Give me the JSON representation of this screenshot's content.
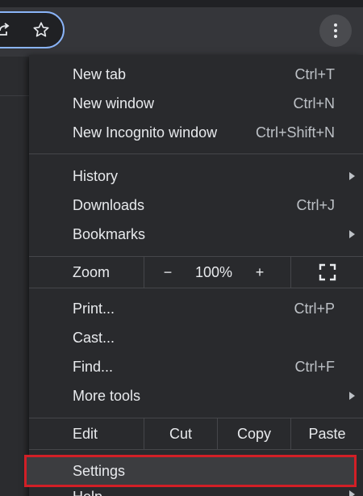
{
  "toolbar": {
    "share_icon": "share-icon",
    "star_icon": "star-icon",
    "menu_icon": "kebab-menu-icon"
  },
  "menu": {
    "group1": [
      {
        "label": "New tab",
        "shortcut": "Ctrl+T"
      },
      {
        "label": "New window",
        "shortcut": "Ctrl+N"
      },
      {
        "label": "New Incognito window",
        "shortcut": "Ctrl+Shift+N"
      }
    ],
    "group2": [
      {
        "label": "History",
        "shortcut": ""
      },
      {
        "label": "Downloads",
        "shortcut": "Ctrl+J"
      },
      {
        "label": "Bookmarks",
        "shortcut": ""
      }
    ],
    "zoom": {
      "label": "Zoom",
      "minus": "−",
      "value": "100%",
      "plus": "+",
      "fullscreen_icon": "fullscreen-icon"
    },
    "group3": [
      {
        "label": "Print...",
        "shortcut": "Ctrl+P"
      },
      {
        "label": "Cast...",
        "shortcut": ""
      },
      {
        "label": "Find...",
        "shortcut": "Ctrl+F"
      },
      {
        "label": "More tools",
        "shortcut": ""
      }
    ],
    "edit": {
      "label": "Edit",
      "cut": "Cut",
      "copy": "Copy",
      "paste": "Paste"
    },
    "settings": {
      "label": "Settings"
    },
    "help": {
      "label": "Help"
    }
  },
  "colors": {
    "menu_bg": "#292a2d",
    "text": "#e8eaed",
    "highlight_border": "#d21f26",
    "omnibox_focus": "#8ab4f8"
  }
}
